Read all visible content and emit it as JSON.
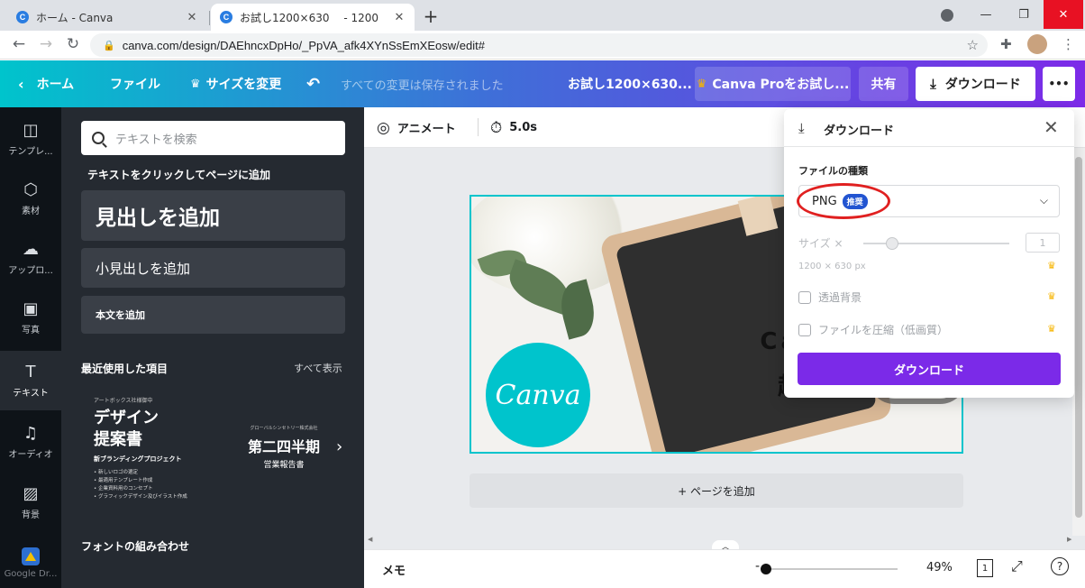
{
  "browser": {
    "tabs": [
      {
        "favicon": "C",
        "title": "ホーム - Canva"
      },
      {
        "favicon": "C",
        "title": "お試し1200×630　 - 1200"
      }
    ],
    "new_tab": "+",
    "url": "canva.com/design/DAEhncxDpHo/_PpVA_afk4XYnSsEmXEosw/edit#"
  },
  "header": {
    "home": "ホーム",
    "file": "ファイル",
    "resize": "サイズを変更",
    "undo_icon": "undo-icon",
    "status": "すべての変更は保存されました",
    "doc_title": "お試し1200×630...",
    "pro": "Canva Proをお試し...",
    "share": "共有",
    "download": "ダウンロード",
    "more": "•••"
  },
  "rail": [
    {
      "icon": "template-icon",
      "label": "テンプレ..."
    },
    {
      "icon": "elements-icon",
      "label": "素材"
    },
    {
      "icon": "upload-icon",
      "label": "アップロ..."
    },
    {
      "icon": "photo-icon",
      "label": "写真"
    },
    {
      "icon": "text-icon",
      "label": "テキスト"
    },
    {
      "icon": "audio-icon",
      "label": "オーディオ"
    },
    {
      "icon": "background-icon",
      "label": "背景"
    },
    {
      "icon": "google-drive-icon",
      "label": "Google Dr..."
    }
  ],
  "panel": {
    "search_placeholder": "テキストを検索",
    "add_hint": "テキストをクリックしてページに追加",
    "heading": "見出しを追加",
    "subheading": "小見出しを追加",
    "body": "本文を追加",
    "recent_title": "最近使用した項目",
    "see_all": "すべて表示",
    "card1": {
      "small": "アートボックス社様御中",
      "big_line1": "デザイン",
      "big_line2": "提案書",
      "sub": "新ブランディングプロジェクト",
      "items": [
        "• 新しいロゴの選定",
        "• 最適用テンプレート作成",
        "• 企業資料用のコンセプト",
        "• グラフィックデザイン及びイラスト作成"
      ]
    },
    "card2": {
      "small": "グローバルシンセトリー株式会社",
      "big": "第二四半期",
      "sub": "営業報告書"
    },
    "font_combo": "フォントの組み合わせ"
  },
  "toolbar": {
    "animate": "アニメート",
    "duration": "5.0s"
  },
  "design": {
    "line1": "Canvaの基本的",
    "line2": "超簡単な使",
    "logo": "Canva"
  },
  "add_page": "+ ページを追加",
  "footer": {
    "memo": "メモ",
    "zoom": "49%",
    "zoom_fraction": 0.0,
    "page_count": "1",
    "help": "?"
  },
  "download_panel": {
    "title": "ダウンロード",
    "filetype_label": "ファイルの種類",
    "filetype": "PNG",
    "badge": "推奨",
    "size_label": "サイズ ×",
    "size_value": "1",
    "size_fraction": 0.2,
    "dimensions": "1200 × 630 px",
    "transparent": "透過背景",
    "compress": "ファイルを圧縮（低画質）",
    "button": "ダウンロード"
  },
  "colors": {
    "accent_teal": "#00c4cc",
    "accent_purple": "#7b2ae8",
    "pro_crown": "#f7b500",
    "annotation_red": "#e02020"
  }
}
